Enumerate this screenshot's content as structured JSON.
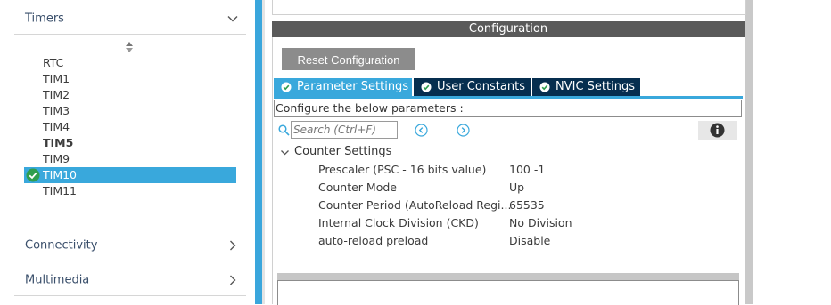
{
  "categories": {
    "timers": {
      "label": "Timers"
    },
    "connectivity": {
      "label": "Connectivity"
    },
    "multimedia": {
      "label": "Multimedia"
    }
  },
  "peripherals": [
    {
      "label": "RTC"
    },
    {
      "label": "TIM1"
    },
    {
      "label": "TIM2"
    },
    {
      "label": "TIM3"
    },
    {
      "label": "TIM4"
    },
    {
      "label": "TIM5"
    },
    {
      "label": "TIM9"
    },
    {
      "label": "TIM10"
    },
    {
      "label": "TIM11"
    }
  ],
  "config": {
    "title": "Configuration",
    "reset_label": "Reset Configuration",
    "tabs": [
      {
        "label": "Parameter Settings"
      },
      {
        "label": "User Constants"
      },
      {
        "label": "NVIC Settings"
      }
    ],
    "hint": "Configure the below parameters :",
    "search_placeholder": "Search (Ctrl+F)",
    "section_title": "Counter Settings",
    "params": [
      {
        "name": "Prescaler (PSC - 16 bits value)",
        "value": "100 -1"
      },
      {
        "name": "Counter Mode",
        "value": "Up"
      },
      {
        "name": "Counter Period (AutoReload Regi...",
        "value": "65535"
      },
      {
        "name": "Internal Clock Division (CKD)",
        "value": "No Division"
      },
      {
        "name": "auto-reload preload",
        "value": "Disable"
      }
    ]
  },
  "colors": {
    "accent": "#39a8dc",
    "tab_inactive": "#062e4f",
    "title_bar": "#5a5a5a",
    "button": "#8c8c8c"
  },
  "icons": {
    "check": "check-circle-icon",
    "search": "search-icon",
    "prev": "arrow-left-circle-icon",
    "next": "arrow-right-circle-icon",
    "info": "info-icon"
  }
}
